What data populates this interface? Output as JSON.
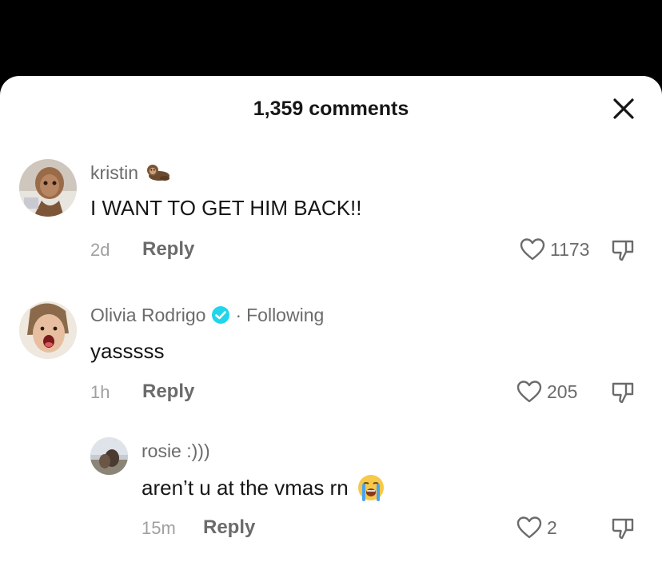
{
  "header": {
    "title": "1,359 comments",
    "close_icon": "close-icon"
  },
  "comments": [
    {
      "username": "kristin",
      "username_emoji": "otter",
      "text": "I WANT TO GET HIM BACK!!",
      "time": "2d",
      "reply_label": "Reply",
      "likes": "1173"
    },
    {
      "username": "Olivia Rodrigo",
      "verified": true,
      "following_label": "Following",
      "text": "yasssss",
      "time": "1h",
      "reply_label": "Reply",
      "likes": "205"
    }
  ],
  "reply": {
    "username": "rosie :)))",
    "text": "aren’t u at the vmas rn",
    "text_emoji": "loudly-crying-face",
    "time": "15m",
    "reply_label": "Reply",
    "likes": "2"
  },
  "colors": {
    "background": "#000000",
    "sheet": "#ffffff",
    "primary_text": "#161616",
    "secondary_text": "#6b6b6b",
    "muted_text": "#a0a0a0",
    "verified": "#20d5ec"
  }
}
